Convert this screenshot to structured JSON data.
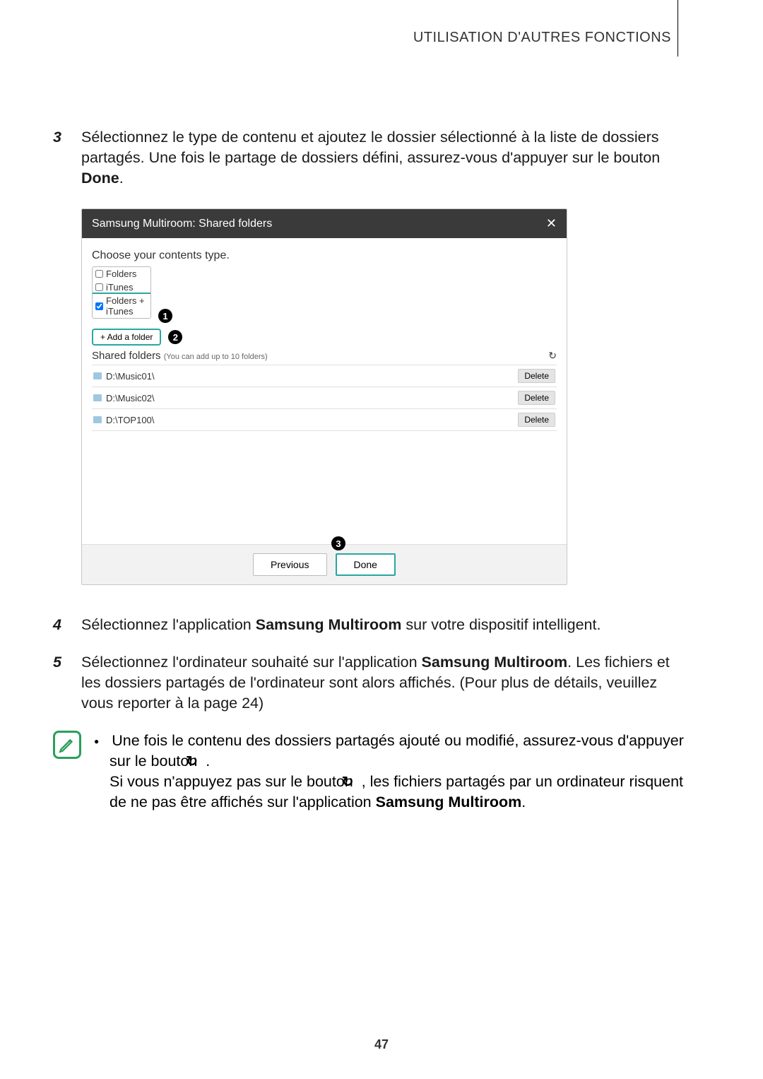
{
  "header": {
    "section": "UTILISATION D'AUTRES FONCTIONS"
  },
  "steps": {
    "s3": {
      "num": "3",
      "pre": "Sélectionnez le type de contenu et ajoutez le dossier sélectionné à la liste de dossiers partagés. Une fois le partage de dossiers défini, assurez-vous d'appuyer sur le bouton ",
      "bold": "Done",
      "post": "."
    },
    "s4": {
      "num": "4",
      "pre": "Sélectionnez l'application ",
      "bold": "Samsung Multiroom",
      "post": " sur votre dispositif intelligent."
    },
    "s5": {
      "num": "5",
      "pre": "Sélectionnez l'ordinateur souhaité sur l'application ",
      "bold": "Samsung Multiroom",
      "post": ". Les fichiers et les dossiers partagés de l'ordinateur sont alors affichés. (Pour plus de détails, veuillez vous reporter à la page 24)"
    }
  },
  "dialog": {
    "title": "Samsung Multiroom: Shared folders",
    "close": "✕",
    "choose": "Choose your contents type.",
    "types": {
      "folders": "Folders",
      "itunes": "iTunes",
      "both": "Folders + iTunes"
    },
    "badge1": "1",
    "add_folder": "+ Add a folder",
    "badge2": "2",
    "shared_label": "Shared folders ",
    "shared_sub": "(You can add up to 10 folders)",
    "refresh": "↻",
    "folders": [
      {
        "path": "D:\\Music01\\",
        "delete": "Delete"
      },
      {
        "path": "D:\\Music02\\",
        "delete": "Delete"
      },
      {
        "path": "D:\\TOP100\\",
        "delete": "Delete"
      }
    ],
    "badge3": "3",
    "previous": "Previous",
    "done": "Done"
  },
  "note": {
    "line1a": "Une fois le contenu des dossiers partagés ajouté ou modifié, assurez-vous d'appuyer sur le bouton ",
    "refresh_glyph": "↻",
    "line1b": " .",
    "line2a": "Si vous n'appuyez pas sur le bouton ",
    "line2b": " , les fichiers partagés par un ordinateur risquent de ne pas être affichés sur l'application ",
    "bold": "Samsung Multiroom",
    "line2c": "."
  },
  "page_number": "47"
}
